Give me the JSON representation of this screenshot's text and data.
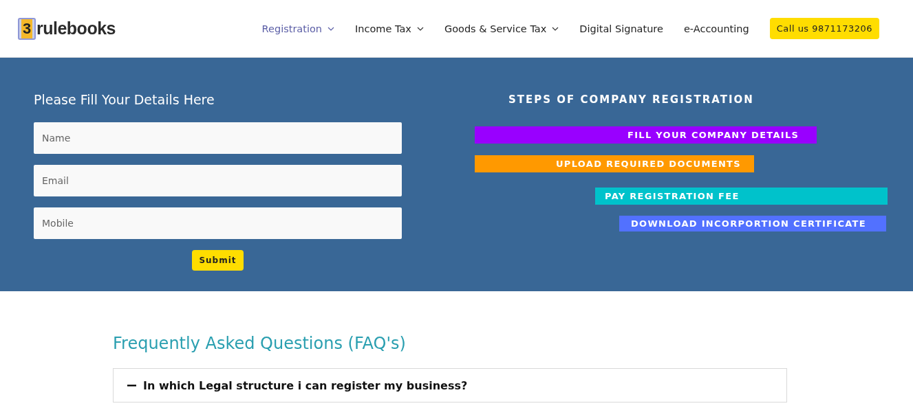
{
  "logo": {
    "mark": "3",
    "text": "rulebooks"
  },
  "nav": [
    {
      "label": "Registration",
      "dropdown": true,
      "selected": true
    },
    {
      "label": "Income Tax",
      "dropdown": true,
      "selected": false
    },
    {
      "label": "Goods & Service Tax",
      "dropdown": true,
      "selected": false
    },
    {
      "label": "Digital Signature",
      "dropdown": false,
      "selected": false
    },
    {
      "label": "e-Accounting",
      "dropdown": false,
      "selected": false
    }
  ],
  "call_button": "Call us 9871173206",
  "form": {
    "title": "Please Fill Your Details Here",
    "fields": [
      {
        "placeholder": "Name"
      },
      {
        "placeholder": "Email"
      },
      {
        "placeholder": "Mobile"
      }
    ],
    "submit": "Submit"
  },
  "steps": {
    "title": "STEPS OF COMPANY REGISTRATION",
    "items": [
      {
        "label": "FILL YOUR COMPANY DETAILS",
        "color": "#9900ff"
      },
      {
        "label": "UPLOAD REQUIRED DOCUMENTS",
        "color": "#ff9900"
      },
      {
        "label": "PAY REGISTRATION FEE",
        "color": "#00c2cb"
      },
      {
        "label": "DOWNLOAD INCORPORTION CERTIFICATE",
        "color": "#5271ff"
      }
    ]
  },
  "faq": {
    "title": "Frequently Asked Questions (FAQ's)",
    "items": [
      {
        "question": "In which Legal structure i can register my business?",
        "expanded": true
      }
    ]
  }
}
